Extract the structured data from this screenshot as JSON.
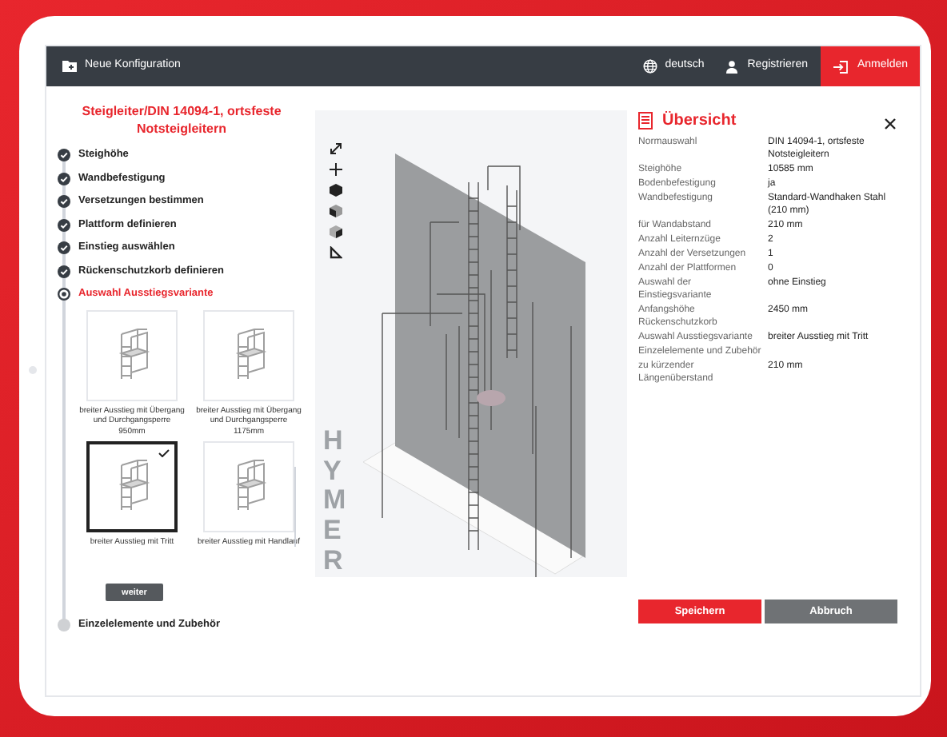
{
  "header": {
    "title": "Neue Konfiguration",
    "language": "deutsch",
    "register": "Registrieren",
    "login": "Anmelden"
  },
  "configurator": {
    "title": "Steigleiter/DIN 14094-1, ortsfeste Notsteigleitern",
    "steps": [
      {
        "label": "Steighöhe",
        "kind": "done"
      },
      {
        "label": "Wandbefestigung",
        "kind": "done"
      },
      {
        "label": "Versetzungen bestimmen",
        "kind": "done"
      },
      {
        "label": "Plattform definieren",
        "kind": "done"
      },
      {
        "label": "Einstieg auswählen",
        "kind": "done"
      },
      {
        "label": "Rückenschutzkorb definieren",
        "kind": "done"
      },
      {
        "label": "Auswahl Ausstiegsvariante",
        "kind": "current",
        "options": [
          {
            "label": "breiter Ausstieg mit Übergang und Durchgangsperre 950mm",
            "selected": false
          },
          {
            "label": "breiter Ausstieg mit Übergang und Durchgangsperre 1175mm",
            "selected": false
          },
          {
            "label": "breiter Ausstieg mit Tritt",
            "selected": true
          },
          {
            "label": "breiter Ausstieg mit Handlauf",
            "selected": false
          }
        ],
        "next_button": "weiter"
      },
      {
        "label": "Einzelelemente und Zubehör",
        "kind": "pending"
      }
    ]
  },
  "viewer": {
    "logo": "HYMER"
  },
  "summary": {
    "title": "Übersicht",
    "rows": [
      {
        "label": "Normauswahl",
        "value": "DIN 14094-1, ortsfeste Notsteigleitern"
      },
      {
        "label": "Steighöhe",
        "value": "10585 mm"
      },
      {
        "label": "Bodenbefestigung",
        "value": "ja"
      },
      {
        "label": "Wandbefestigung",
        "value": "Standard-Wandhaken Stahl (210 mm)"
      },
      {
        "label": "für Wandabstand",
        "value": "210 mm"
      },
      {
        "label": "Anzahl Leiternzüge",
        "value": "2"
      },
      {
        "label": "Anzahl der Versetzungen",
        "value": "1"
      },
      {
        "label": "Anzahl der Plattformen",
        "value": "0"
      },
      {
        "label": "Auswahl der Einstiegsvariante",
        "value": "ohne Einstieg"
      },
      {
        "label": "Anfangshöhe Rückenschutzkorb",
        "value": "2450 mm"
      },
      {
        "label": "Auswahl Ausstiegsvariante",
        "value": "breiter Ausstieg mit Tritt"
      },
      {
        "label": "Einzelelemente und Zubehör"
      },
      {
        "label": "zu kürzender Längenüberstand",
        "value": "210 mm"
      }
    ],
    "save_button": "Speichern",
    "cancel_button": "Abbruch"
  }
}
